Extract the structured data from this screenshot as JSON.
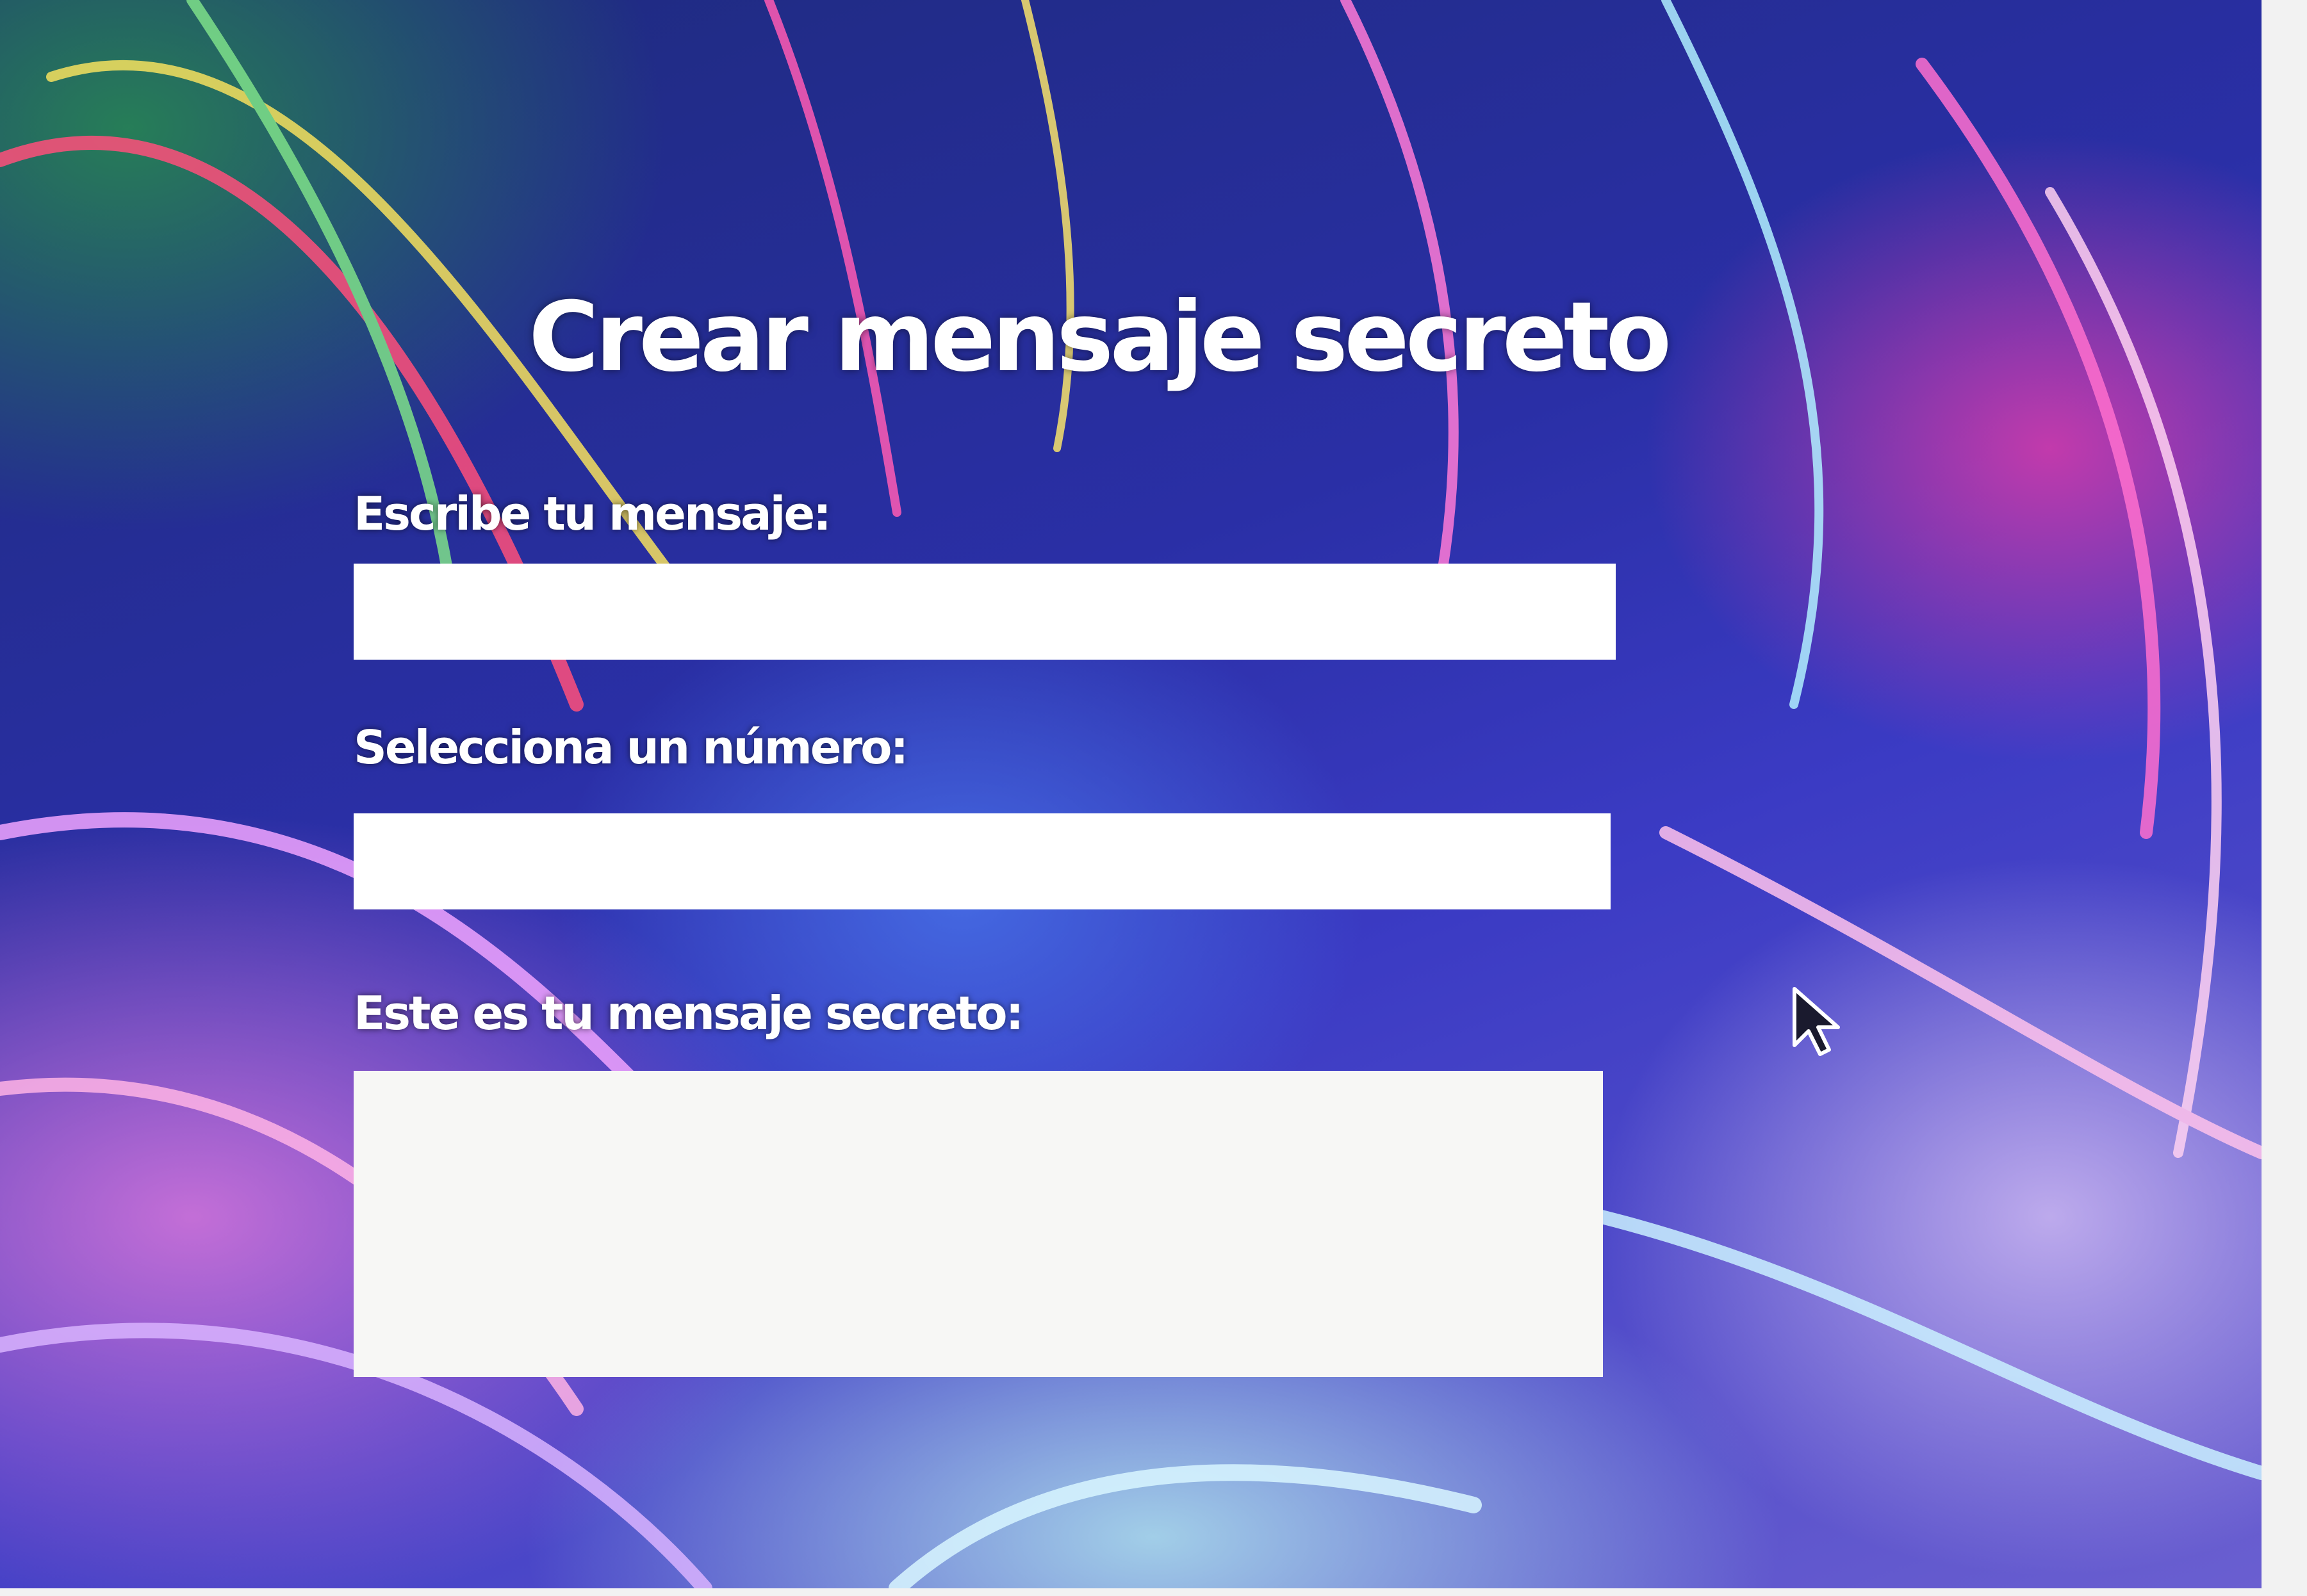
{
  "app": {
    "title": "Crear mensaje secreto"
  },
  "form": {
    "message_label": "Escribe tu mensaje:",
    "message_value": "",
    "number_label": "Selecciona un número:",
    "number_value": "",
    "secret_label": "Este es tu mensaje secreto:",
    "secret_value": ""
  },
  "icons": {
    "cursor": "mouse-pointer-icon"
  },
  "colors": {
    "field_background": "#ffffff",
    "text": "#ffffff"
  }
}
